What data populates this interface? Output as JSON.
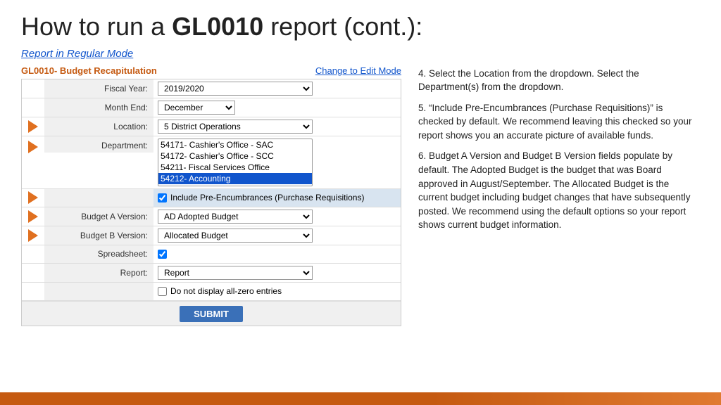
{
  "title": {
    "prefix": "How to run a ",
    "highlight": "GL0010",
    "suffix": " report (cont.):"
  },
  "report_mode_label": "Report in Regular Mode",
  "form": {
    "title": "GL0010- Budget Recapitulation",
    "change_mode": "Change to Edit Mode",
    "fields": {
      "fiscal_year": {
        "label": "Fiscal Year:",
        "value": "2019/2020"
      },
      "month_end": {
        "label": "Month End:",
        "value": "December"
      },
      "location": {
        "label": "Location:",
        "value": "5 District Operations"
      },
      "department": {
        "label": "Department:",
        "options": [
          "54171- Cashier's Office - SAC",
          "54172- Cashier's Office - SCC",
          "54211- Fiscal Services Office",
          "54212- Accounting"
        ],
        "selected": "54212- Accounting"
      },
      "include_pre_encumbrances": {
        "label": "",
        "text": "Include Pre-Encumbrances (Purchase Requisitions)"
      },
      "budget_a": {
        "label": "Budget A Version:",
        "value": "AD Adopted Budget"
      },
      "budget_b": {
        "label": "Budget B Version:",
        "value": "Allocated Budget"
      },
      "spreadsheet": {
        "label": "Spreadsheet:"
      },
      "report": {
        "label": "Report:",
        "value": "Report"
      },
      "no_display": {
        "text": "Do not display all-zero entries"
      },
      "submit_label": "SUBMIT"
    }
  },
  "right_panel": {
    "point4": "4. Select the Location from the dropdown. Select the Department(s) from the dropdown.",
    "point5": "5. “Include Pre-Encumbrances (Purchase Requisitions)” is checked by default. We recommend leaving this checked so your report shows you an accurate picture of available funds.",
    "point6": "6. Budget A Version and Budget B Version fields populate by default.  The Adopted Budget is the budget that was Board approved in August/September.  The Allocated Budget is the current budget including budget changes that have subsequently posted.  We recommend using the default options so your report shows current budget information."
  }
}
